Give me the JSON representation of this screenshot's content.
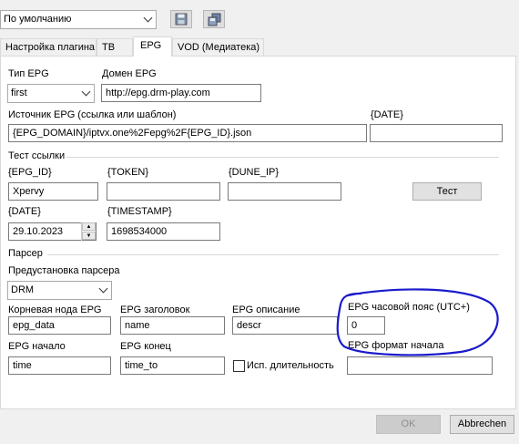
{
  "toolbar": {
    "preset_value": "По умолчанию",
    "save_icon": "save-icon",
    "copy_icon": "copy-icon"
  },
  "tabs": [
    {
      "label": "Настройка плагина",
      "active": false
    },
    {
      "label": "ТВ",
      "active": false
    },
    {
      "label": "EPG",
      "active": true
    },
    {
      "label": "VOD (Медиатека)",
      "active": false
    }
  ],
  "epg": {
    "type_label": "Тип EPG",
    "type_value": "first",
    "domain_label": "Домен EPG",
    "domain_value": "http://epg.drm-play.com",
    "source_label": "Источник EPG (ссылка или шаблон)",
    "source_value": "{EPG_DOMAIN}/iptvx.one%2Fepg%2F{EPG_ID}.json",
    "date_label": "{DATE}",
    "date_value": ""
  },
  "test": {
    "section_label": "Тест ссылки",
    "epg_id_label": "{EPG_ID}",
    "epg_id_value": "Xpervy",
    "token_label": "{TOKEN}",
    "token_value": "",
    "dune_ip_label": "{DUNE_IP}",
    "dune_ip_value": "",
    "test_button": "Тест",
    "date_label": "{DATE}",
    "date_value": "29.10.2023",
    "timestamp_label": "{TIMESTAMP}",
    "timestamp_value": "1698534000"
  },
  "parser": {
    "section_label": "Парсер",
    "preset_label": "Предустановка парсера",
    "preset_value": "DRM",
    "root_label": "Корневая нода EPG",
    "root_value": "epg_data",
    "title_label": "EPG заголовок",
    "title_value": "name",
    "desc_label": "EPG описание",
    "desc_value": "descr",
    "tz_label": "EPG часовой пояс (UTC+)",
    "tz_value": "0",
    "start_label": "EPG начало",
    "start_value": "time",
    "end_label": "EPG конец",
    "end_value": "time_to",
    "duration_label": "Исп. длительность",
    "duration_checked": false,
    "start_format_label": "EPG формат начала",
    "start_format_value": ""
  },
  "footer": {
    "ok_label": "OK",
    "cancel_label": "Abbrechen"
  },
  "colors": {
    "annotation": "#1a1acc",
    "panel": "#ffffff",
    "window": "#f0f0f0"
  }
}
